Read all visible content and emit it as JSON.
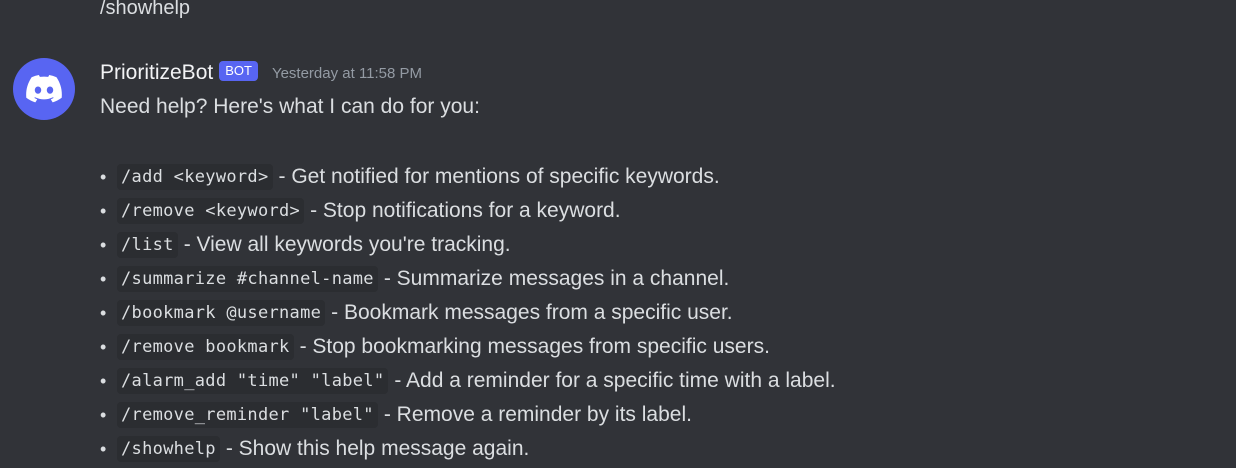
{
  "previous_message": {
    "text": "/showhelp"
  },
  "message": {
    "avatar_icon": "discord-logo-icon",
    "username": "PrioritizeBot",
    "bot_tag": "BOT",
    "timestamp": "Yesterday at 11:58 PM",
    "intro": "Need help? Here's what I can do for you:",
    "bullet": "•",
    "commands": [
      {
        "cmd": "/add <keyword>",
        "desc": "- Get notified for mentions of specific keywords."
      },
      {
        "cmd": "/remove <keyword>",
        "desc": "- Stop notifications for a keyword."
      },
      {
        "cmd": "/list",
        "desc": "- View all keywords you're tracking."
      },
      {
        "cmd": "/summarize #channel-name",
        "desc": "- Summarize messages in a channel."
      },
      {
        "cmd": "/bookmark @username",
        "desc": "- Bookmark messages from a specific user."
      },
      {
        "cmd": "/remove bookmark",
        "desc": "- Stop bookmarking messages from specific users."
      },
      {
        "cmd": "/alarm_add \"time\" \"label\"",
        "desc": "- Add a reminder for a specific time with a label."
      },
      {
        "cmd": "/remove_reminder \"label\"",
        "desc": "- Remove a reminder by its label."
      },
      {
        "cmd": "/showhelp",
        "desc": "- Show this help message again."
      }
    ]
  },
  "colors": {
    "background": "#313338",
    "accent": "#5865f2",
    "text": "#dbdee1",
    "muted": "#949ba4",
    "code_bg": "#2b2d31"
  }
}
